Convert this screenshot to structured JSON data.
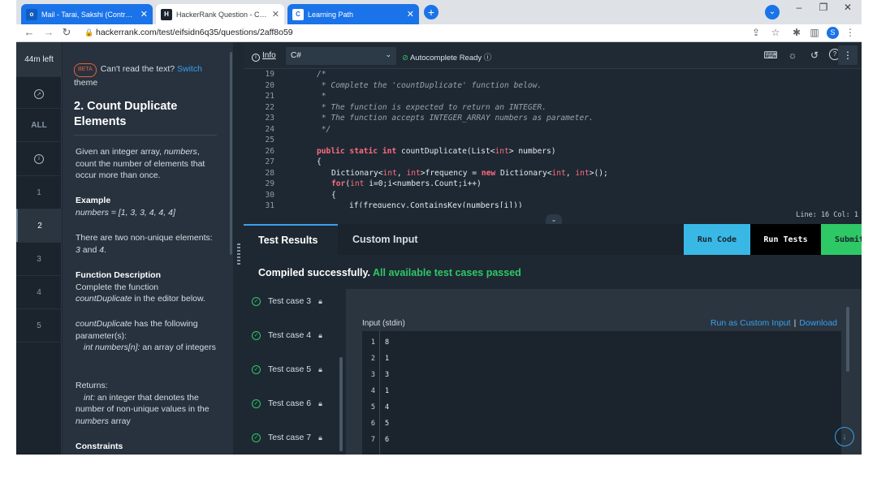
{
  "browser": {
    "tabs": [
      {
        "title": "Mail - Tarai, Sakshi (Contractor) -",
        "favicon": "outlook-icon",
        "color": "#1a73e8"
      },
      {
        "title": "HackerRank Question - Count Du",
        "favicon": "hackerrank-icon",
        "color": "#1b242d"
      },
      {
        "title": "Learning Path",
        "favicon": "c-icon",
        "color": "#1a73e8"
      }
    ],
    "url": "hackerrank.com/test/eifsidn6q35/questions/2aff8o59",
    "profile_initial": "S"
  },
  "rail": {
    "timer": "44m left",
    "all_label": "ALL",
    "numbers": [
      "1",
      "2",
      "3",
      "4",
      "5"
    ],
    "active": "2"
  },
  "problem": {
    "beta_badge": "BETA",
    "notice_text": "Can't read the text?",
    "notice_link": "Switch",
    "notice_tail": "theme",
    "title": "2. Count Duplicate Elements",
    "desc_pre": "Given an integer array,",
    "desc_em": "numbers",
    "desc_post": ", count the number of elements that occur more than once.",
    "example_heading": "Example",
    "example_value": "numbers = [1, 3, 3, 4, 4, 4]",
    "nonunique_pre": "There are two non-unique elements:",
    "nonunique_a": "3",
    "nonunique_and": " and ",
    "nonunique_b": "4",
    "nonunique_dot": ".",
    "fd_heading": "Function Description",
    "fd_text_pre": "Complete the function",
    "fd_text_em": "countDuplicate",
    "fd_text_post": " in the editor below.",
    "params_em": "countDuplicate",
    "params_post": " has the following parameter(s):",
    "param1_em": "int numbers[n]:",
    "param1_post": "  an array of integers",
    "returns_heading": "Returns:",
    "returns_em": "int:",
    "returns_post": " an integer that denotes the number of non-unique values in the",
    "returns_em2": "numbers",
    "returns_post2": " array",
    "constraints_heading": "Constraints"
  },
  "editor": {
    "info_label": "Info",
    "language": "C#",
    "autocomplete": "Autocomplete Ready",
    "line_numbers": [
      "19",
      "20",
      "21",
      "22",
      "23",
      "24",
      "25",
      "26",
      "27",
      "28",
      "29",
      "30",
      "31"
    ],
    "status": "Line: 16 Col: 1"
  },
  "code": {
    "l19": "/*",
    "l20": " * Complete the 'countDuplicate' function below.",
    "l21": " *",
    "l22": " * The function is expected to return an INTEGER.",
    "l23": " * The function accepts INTEGER_ARRAY numbers as parameter.",
    "l24": " */",
    "l26_kw": "public static int",
    "l26_rest": " countDuplicate(List<",
    "l26_ty": "int",
    "l26_end": "> numbers)",
    "l27": "{",
    "l28_a": "Dictionary<",
    "l28_ty1": "int",
    "l28_b": ", ",
    "l28_ty2": "int",
    "l28_c": ">frequency = ",
    "l28_kw": "new",
    "l28_d": " Dictionary<",
    "l28_ty3": "int",
    "l28_e": ", ",
    "l28_ty4": "int",
    "l28_f": ">();",
    "l29_kw": "for",
    "l29_a": "(",
    "l29_ty": "int",
    "l29_b": " i=0;i<numbers.Count;i++)",
    "l30": "{",
    "l31": "if(frequency.ContainsKey(numbers[i]))"
  },
  "results": {
    "tab_test_results": "Test Results",
    "tab_custom_input": "Custom Input",
    "run_code": "Run Code",
    "run_tests": "Run Tests",
    "submit": "Submit",
    "compiled": "Compiled successfully.",
    "passed": "All available test cases passed",
    "cases": [
      "Test case 3",
      "Test case 4",
      "Test case 5",
      "Test case 6",
      "Test case 7"
    ],
    "input_label": "Input (stdin)",
    "run_custom": "Run as Custom Input",
    "pipe": "|",
    "download": "Download",
    "stdin_lines": [
      "1",
      "2",
      "3",
      "4",
      "5",
      "6",
      "7"
    ],
    "stdin_values": [
      "8",
      "1",
      "3",
      "1",
      "4",
      "5",
      "6"
    ]
  },
  "colors": {
    "accent_blue": "#39a0ed",
    "success_green": "#2ec866",
    "run_code_bg": "#39b8e6",
    "submit_bg": "#2ec866",
    "run_tests_bg": "#000000"
  }
}
